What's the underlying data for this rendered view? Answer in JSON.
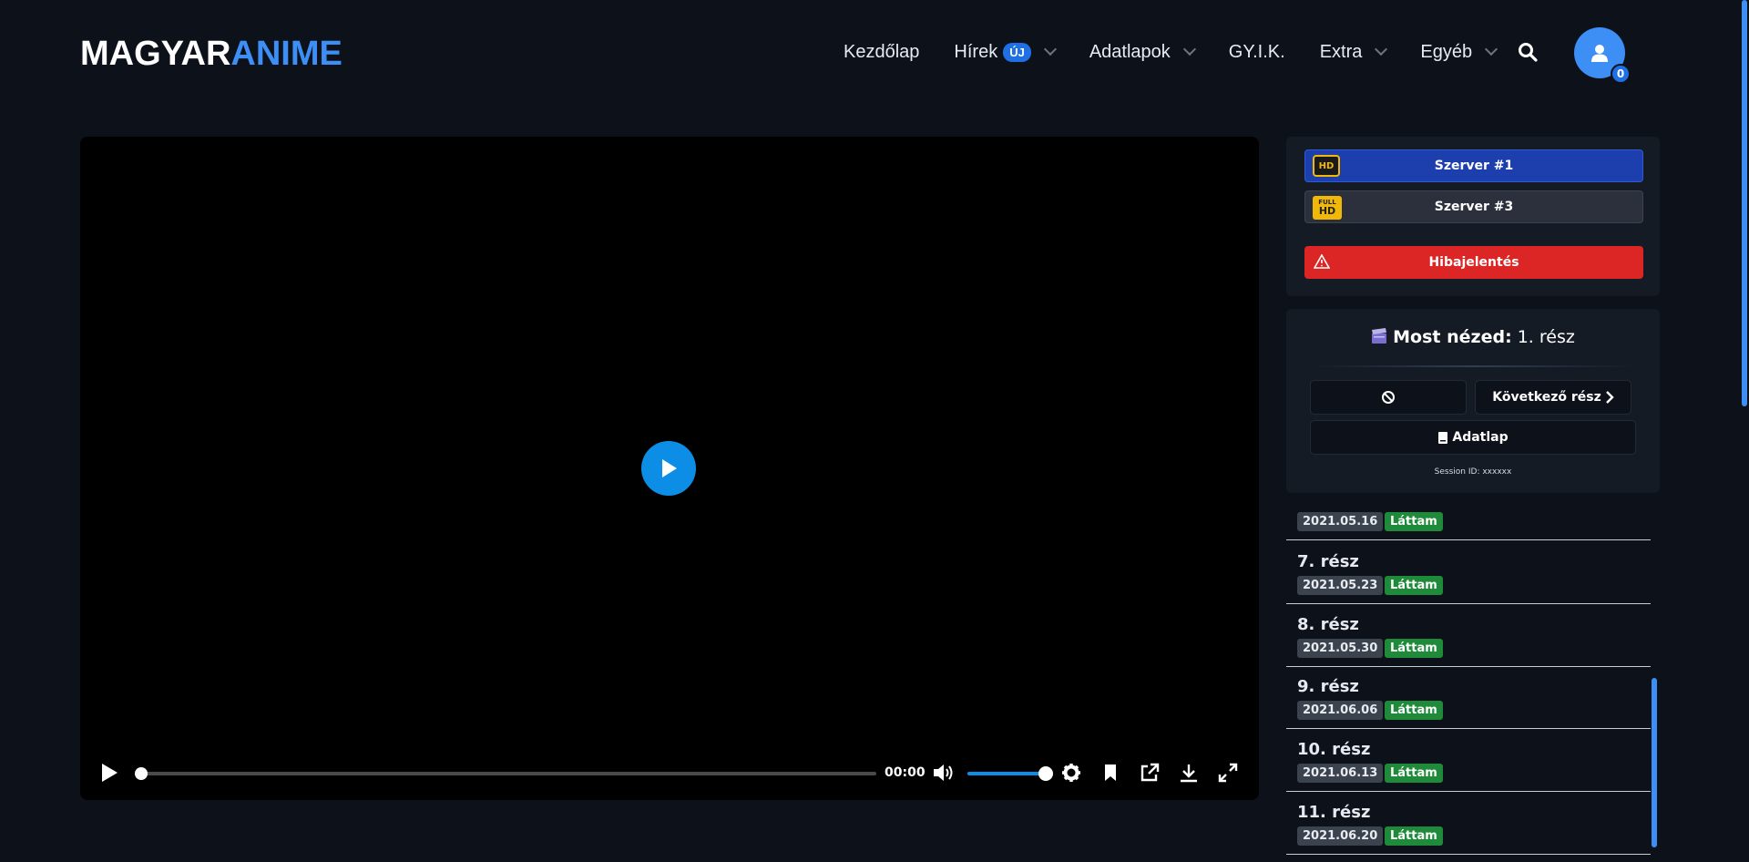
{
  "logo": {
    "part1": "MAGYAR",
    "part2": "ANIME"
  },
  "nav": {
    "home": "Kezdőlap",
    "news": "Hírek",
    "news_badge": "ÚJ",
    "datasheets": "Adatlapok",
    "faq": "GY.I.K.",
    "extra": "Extra",
    "other": "Egyéb"
  },
  "user": {
    "notification_count": "0"
  },
  "player": {
    "time": "00:00",
    "progress": 0.0,
    "volume": 1.0
  },
  "servers": {
    "server1_label": "Szerver #1",
    "server1_quality": "HD",
    "server3_label": "Szerver #3",
    "server3_quality_top": "FULL",
    "server3_quality_bottom": "HD",
    "report_label": "Hibajelentés"
  },
  "now": {
    "prefix": "Most nézed:",
    "episode": "1. rész",
    "next_label": "Következő rész",
    "datasheet_label": "Adatlap",
    "session": "Session ID: xxxxxx"
  },
  "episodes": [
    {
      "title": "",
      "date": "2021.05.16",
      "status": "Láttam"
    },
    {
      "title": "7. rész",
      "date": "2021.05.23",
      "status": "Láttam"
    },
    {
      "title": "8. rész",
      "date": "2021.05.30",
      "status": "Láttam"
    },
    {
      "title": "9. rész",
      "date": "2021.06.06",
      "status": "Láttam"
    },
    {
      "title": "10. rész",
      "date": "2021.06.13",
      "status": "Láttam"
    },
    {
      "title": "11. rész",
      "date": "2021.06.20",
      "status": "Láttam"
    }
  ],
  "colors": {
    "accent": "#3d8ff5",
    "player_accent": "#0c8ee6",
    "server_active": "#1d3fae",
    "report": "#dc2626",
    "seen": "#1f8a3a"
  }
}
